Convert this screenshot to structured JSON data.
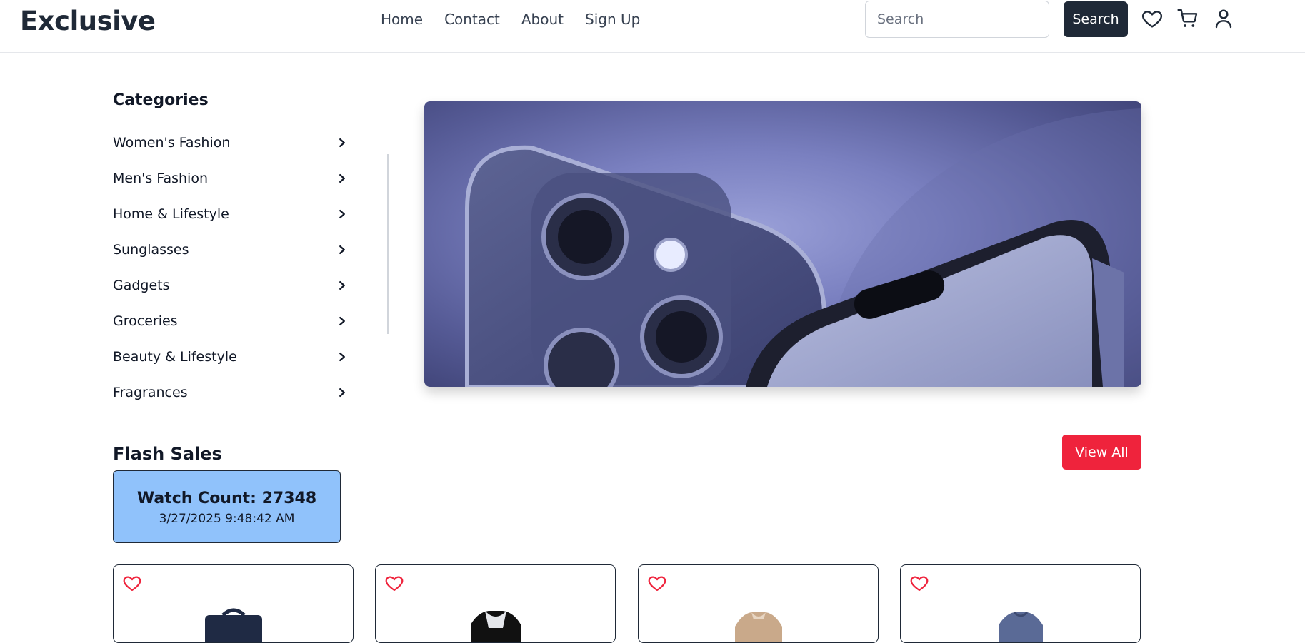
{
  "header": {
    "logo": "Exclusive",
    "nav": [
      {
        "label": "Home"
      },
      {
        "label": "Contact"
      },
      {
        "label": "About"
      },
      {
        "label": "Sign Up"
      }
    ],
    "search": {
      "placeholder": "Search",
      "value": ""
    },
    "search_button": "Search",
    "icons": [
      "heart-icon",
      "cart-icon",
      "user-icon"
    ]
  },
  "categories": {
    "title": "Categories",
    "items": [
      {
        "label": "Women's Fashion"
      },
      {
        "label": "Men's Fashion"
      },
      {
        "label": "Home & Lifestyle"
      },
      {
        "label": "Sunglasses"
      },
      {
        "label": "Gadgets"
      },
      {
        "label": "Groceries"
      },
      {
        "label": "Beauty & Lifestyle"
      },
      {
        "label": "Fragrances"
      }
    ]
  },
  "hero": {
    "image": "phone-banner"
  },
  "flash_sales": {
    "title": "Flash Sales",
    "view_all": "View All",
    "watch_count_label": "Watch Count: 27348",
    "watch_time": "3/27/2025 9:48:42 AM"
  },
  "products": [
    {
      "image": "bag"
    },
    {
      "image": "jersey"
    },
    {
      "image": "jacket"
    },
    {
      "image": "shirt"
    }
  ],
  "colors": {
    "accent": "#ef233c",
    "dark": "#1f2937",
    "watch_bg": "#90c2fb"
  }
}
